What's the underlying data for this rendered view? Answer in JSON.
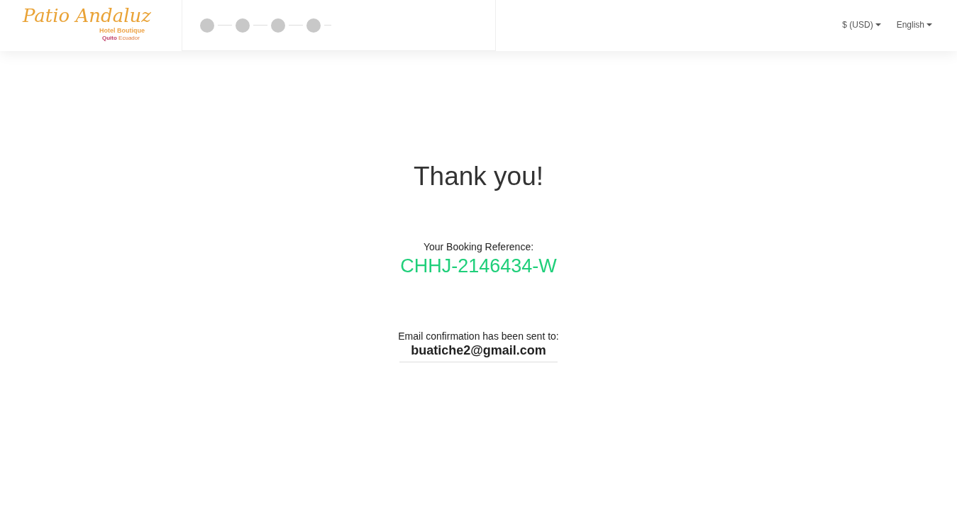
{
  "logo": {
    "name": "Patio Andaluz",
    "subtitle": "Hotel Boutique",
    "city": "Quito",
    "country": "Ecuador"
  },
  "header": {
    "currency": "$ (USD)",
    "language": "English"
  },
  "confirmation": {
    "title": "Thank you!",
    "reference_label": "Your Booking Reference:",
    "reference": "CHHJ-2146434-W",
    "email_label": "Email confirmation has been sent to:",
    "email": "buatiche2@gmail.com"
  }
}
